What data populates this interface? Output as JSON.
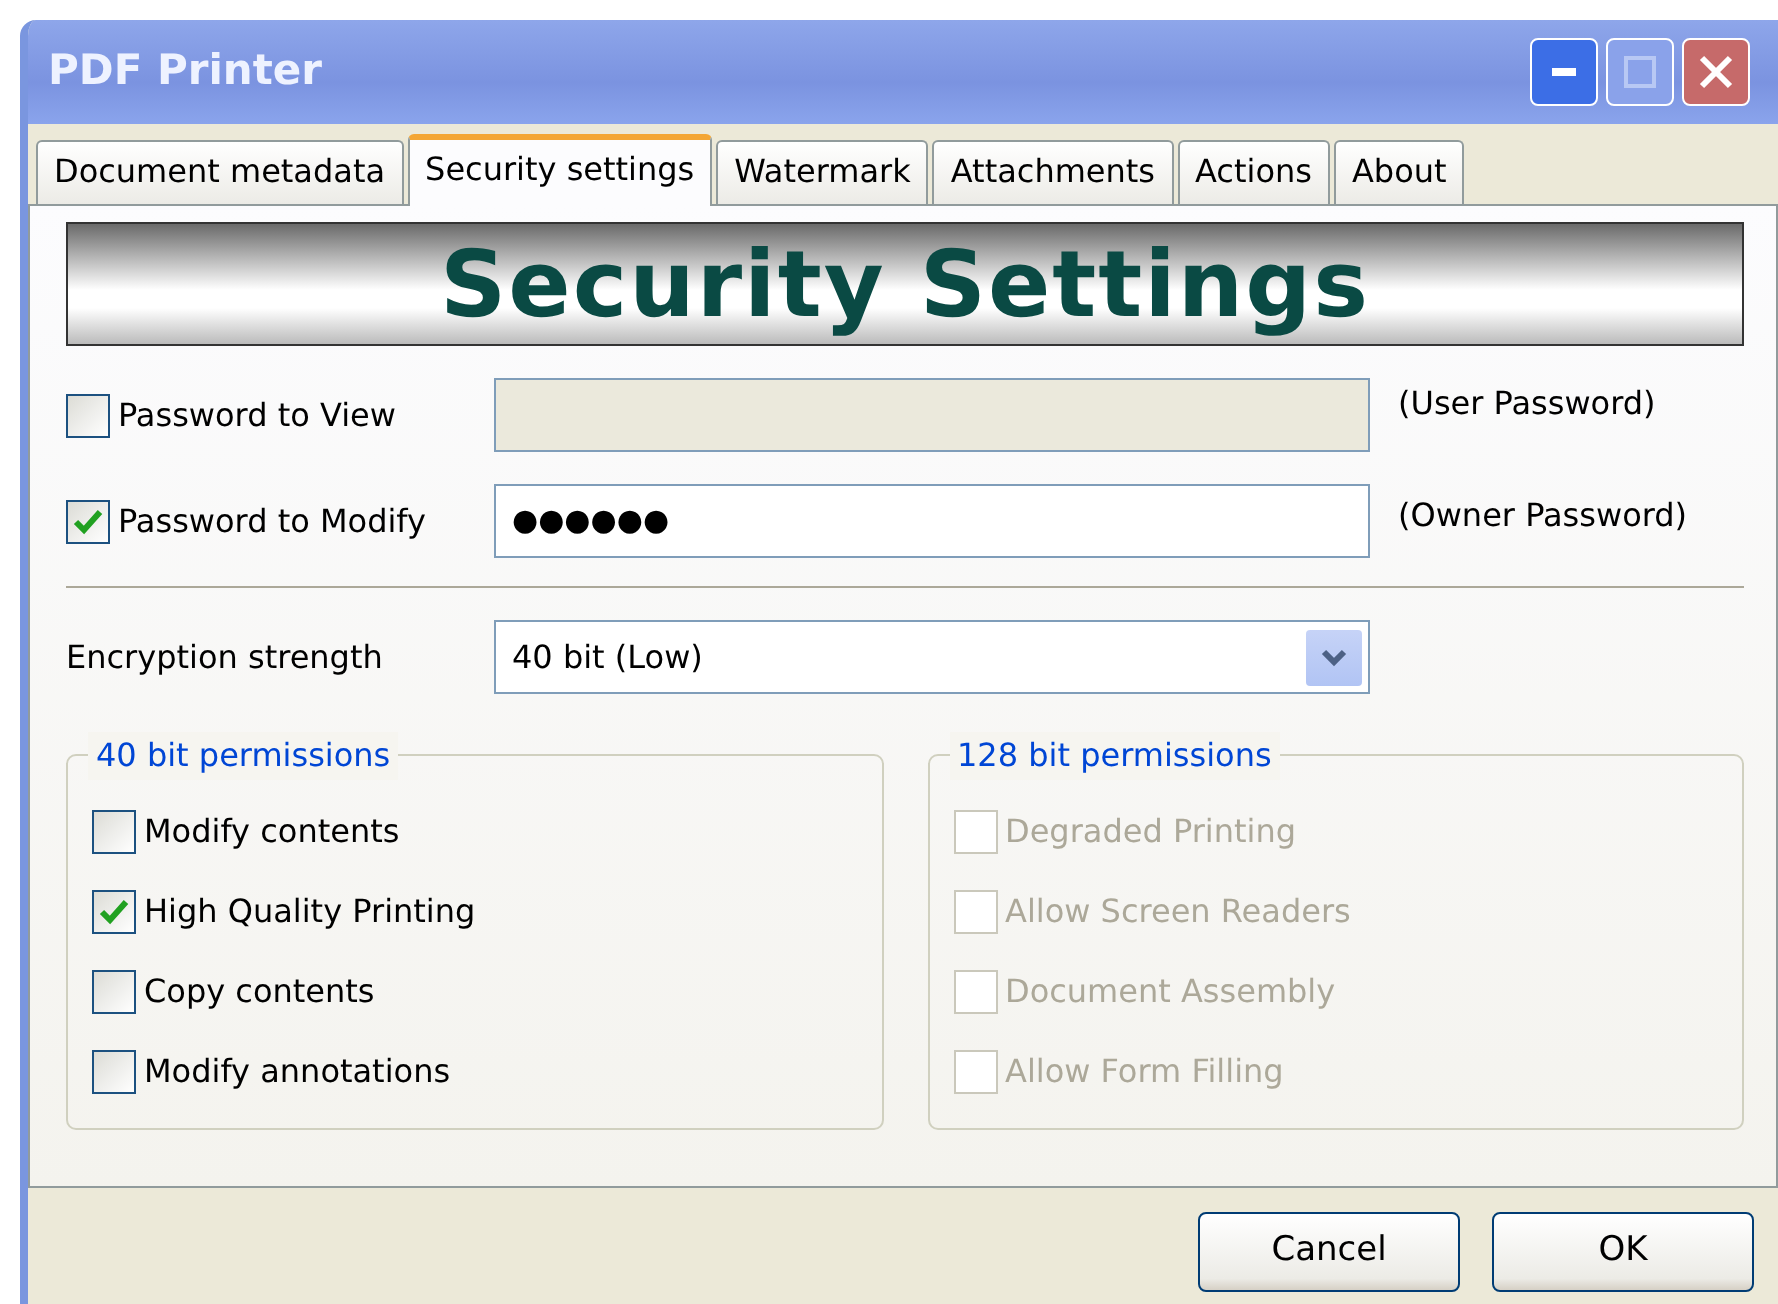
{
  "window": {
    "title": "PDF Printer"
  },
  "tabs": [
    {
      "label": "Document metadata",
      "selected": false
    },
    {
      "label": "Security settings",
      "selected": true
    },
    {
      "label": "Watermark",
      "selected": false
    },
    {
      "label": "Attachments",
      "selected": false
    },
    {
      "label": "Actions",
      "selected": false
    },
    {
      "label": "About",
      "selected": false
    }
  ],
  "banner": "Security Settings",
  "passwords": [
    {
      "label": "Password to View",
      "checked": false,
      "disabled": true,
      "note": "(User Password)"
    },
    {
      "label": "Password to Modify",
      "checked": true,
      "value": "●●●●●●",
      "disabled": false,
      "note": "(Owner Password)"
    }
  ],
  "encryption": {
    "label": "Encryption strength",
    "value": "40 bit (Low)"
  },
  "groups": [
    {
      "title": "40 bit permissions",
      "disabled": false,
      "items": [
        {
          "label": "Modify contents",
          "checked": false
        },
        {
          "label": "High Quality Printing",
          "checked": true
        },
        {
          "label": "Copy contents",
          "checked": false
        },
        {
          "label": "Modify annotations",
          "checked": false
        }
      ]
    },
    {
      "title": "128 bit permissions",
      "disabled": true,
      "items": [
        {
          "label": "Degraded Printing",
          "checked": false
        },
        {
          "label": "Allow Screen Readers",
          "checked": false
        },
        {
          "label": "Document Assembly",
          "checked": false
        },
        {
          "label": "Allow Form Filling",
          "checked": false
        }
      ]
    }
  ],
  "buttons": [
    "Cancel",
    "OK"
  ]
}
